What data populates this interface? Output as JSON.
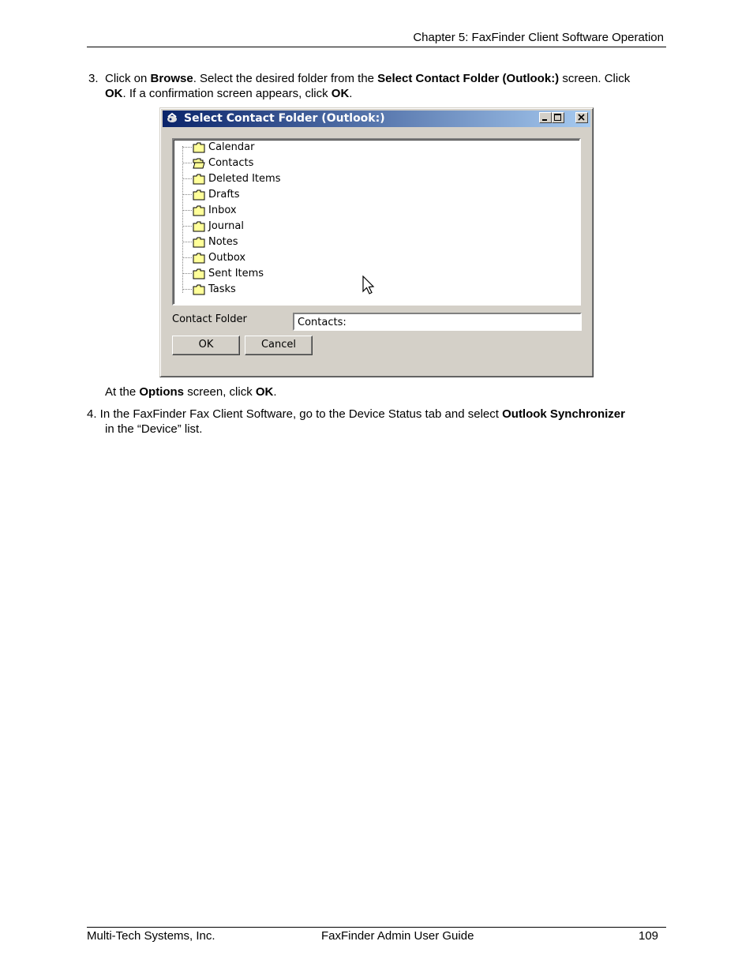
{
  "header": {
    "chapter": "Chapter 5: FaxFinder Client Software Operation"
  },
  "step3": {
    "number": "3.",
    "t1": "Click on ",
    "b1": "Browse",
    "t2": ". Select the desired folder from the ",
    "b2": "Select Contact Folder (Outlook:)",
    "t3": " screen.  Click",
    "b3": "OK",
    "t4": ".  If a confirmation screen appears, click ",
    "b4": "OK",
    "t5": "."
  },
  "dialog": {
    "title": "Select Contact Folder (Outlook:)",
    "folders": [
      {
        "label": "Calendar",
        "icon": "folder-closed-icon"
      },
      {
        "label": "Contacts",
        "icon": "folder-open-icon"
      },
      {
        "label": "Deleted Items",
        "icon": "folder-closed-icon"
      },
      {
        "label": "Drafts",
        "icon": "folder-closed-icon"
      },
      {
        "label": "Inbox",
        "icon": "folder-closed-icon"
      },
      {
        "label": "Journal",
        "icon": "folder-closed-icon"
      },
      {
        "label": "Notes",
        "icon": "folder-closed-icon"
      },
      {
        "label": "Outbox",
        "icon": "folder-closed-icon"
      },
      {
        "label": "Sent Items",
        "icon": "folder-closed-icon"
      },
      {
        "label": "Tasks",
        "icon": "folder-closed-icon"
      }
    ],
    "contact_folder_label": "Contact Folder",
    "contact_folder_value": "Contacts:",
    "ok_label": "OK",
    "cancel_label": "Cancel"
  },
  "options_line": {
    "t1": "At the ",
    "b1": "Options",
    "t2": " screen, click ",
    "b2": "OK",
    "t3": "."
  },
  "step4": {
    "t1": "4. In the FaxFinder Fax Client Software, go to the Device Status tab and select ",
    "b1": "Outlook Synchronizer",
    "t2": "in the “Device” list."
  },
  "footer": {
    "company": "Multi-Tech Systems, Inc.",
    "guide": "FaxFinder Admin User Guide",
    "page": "109"
  }
}
